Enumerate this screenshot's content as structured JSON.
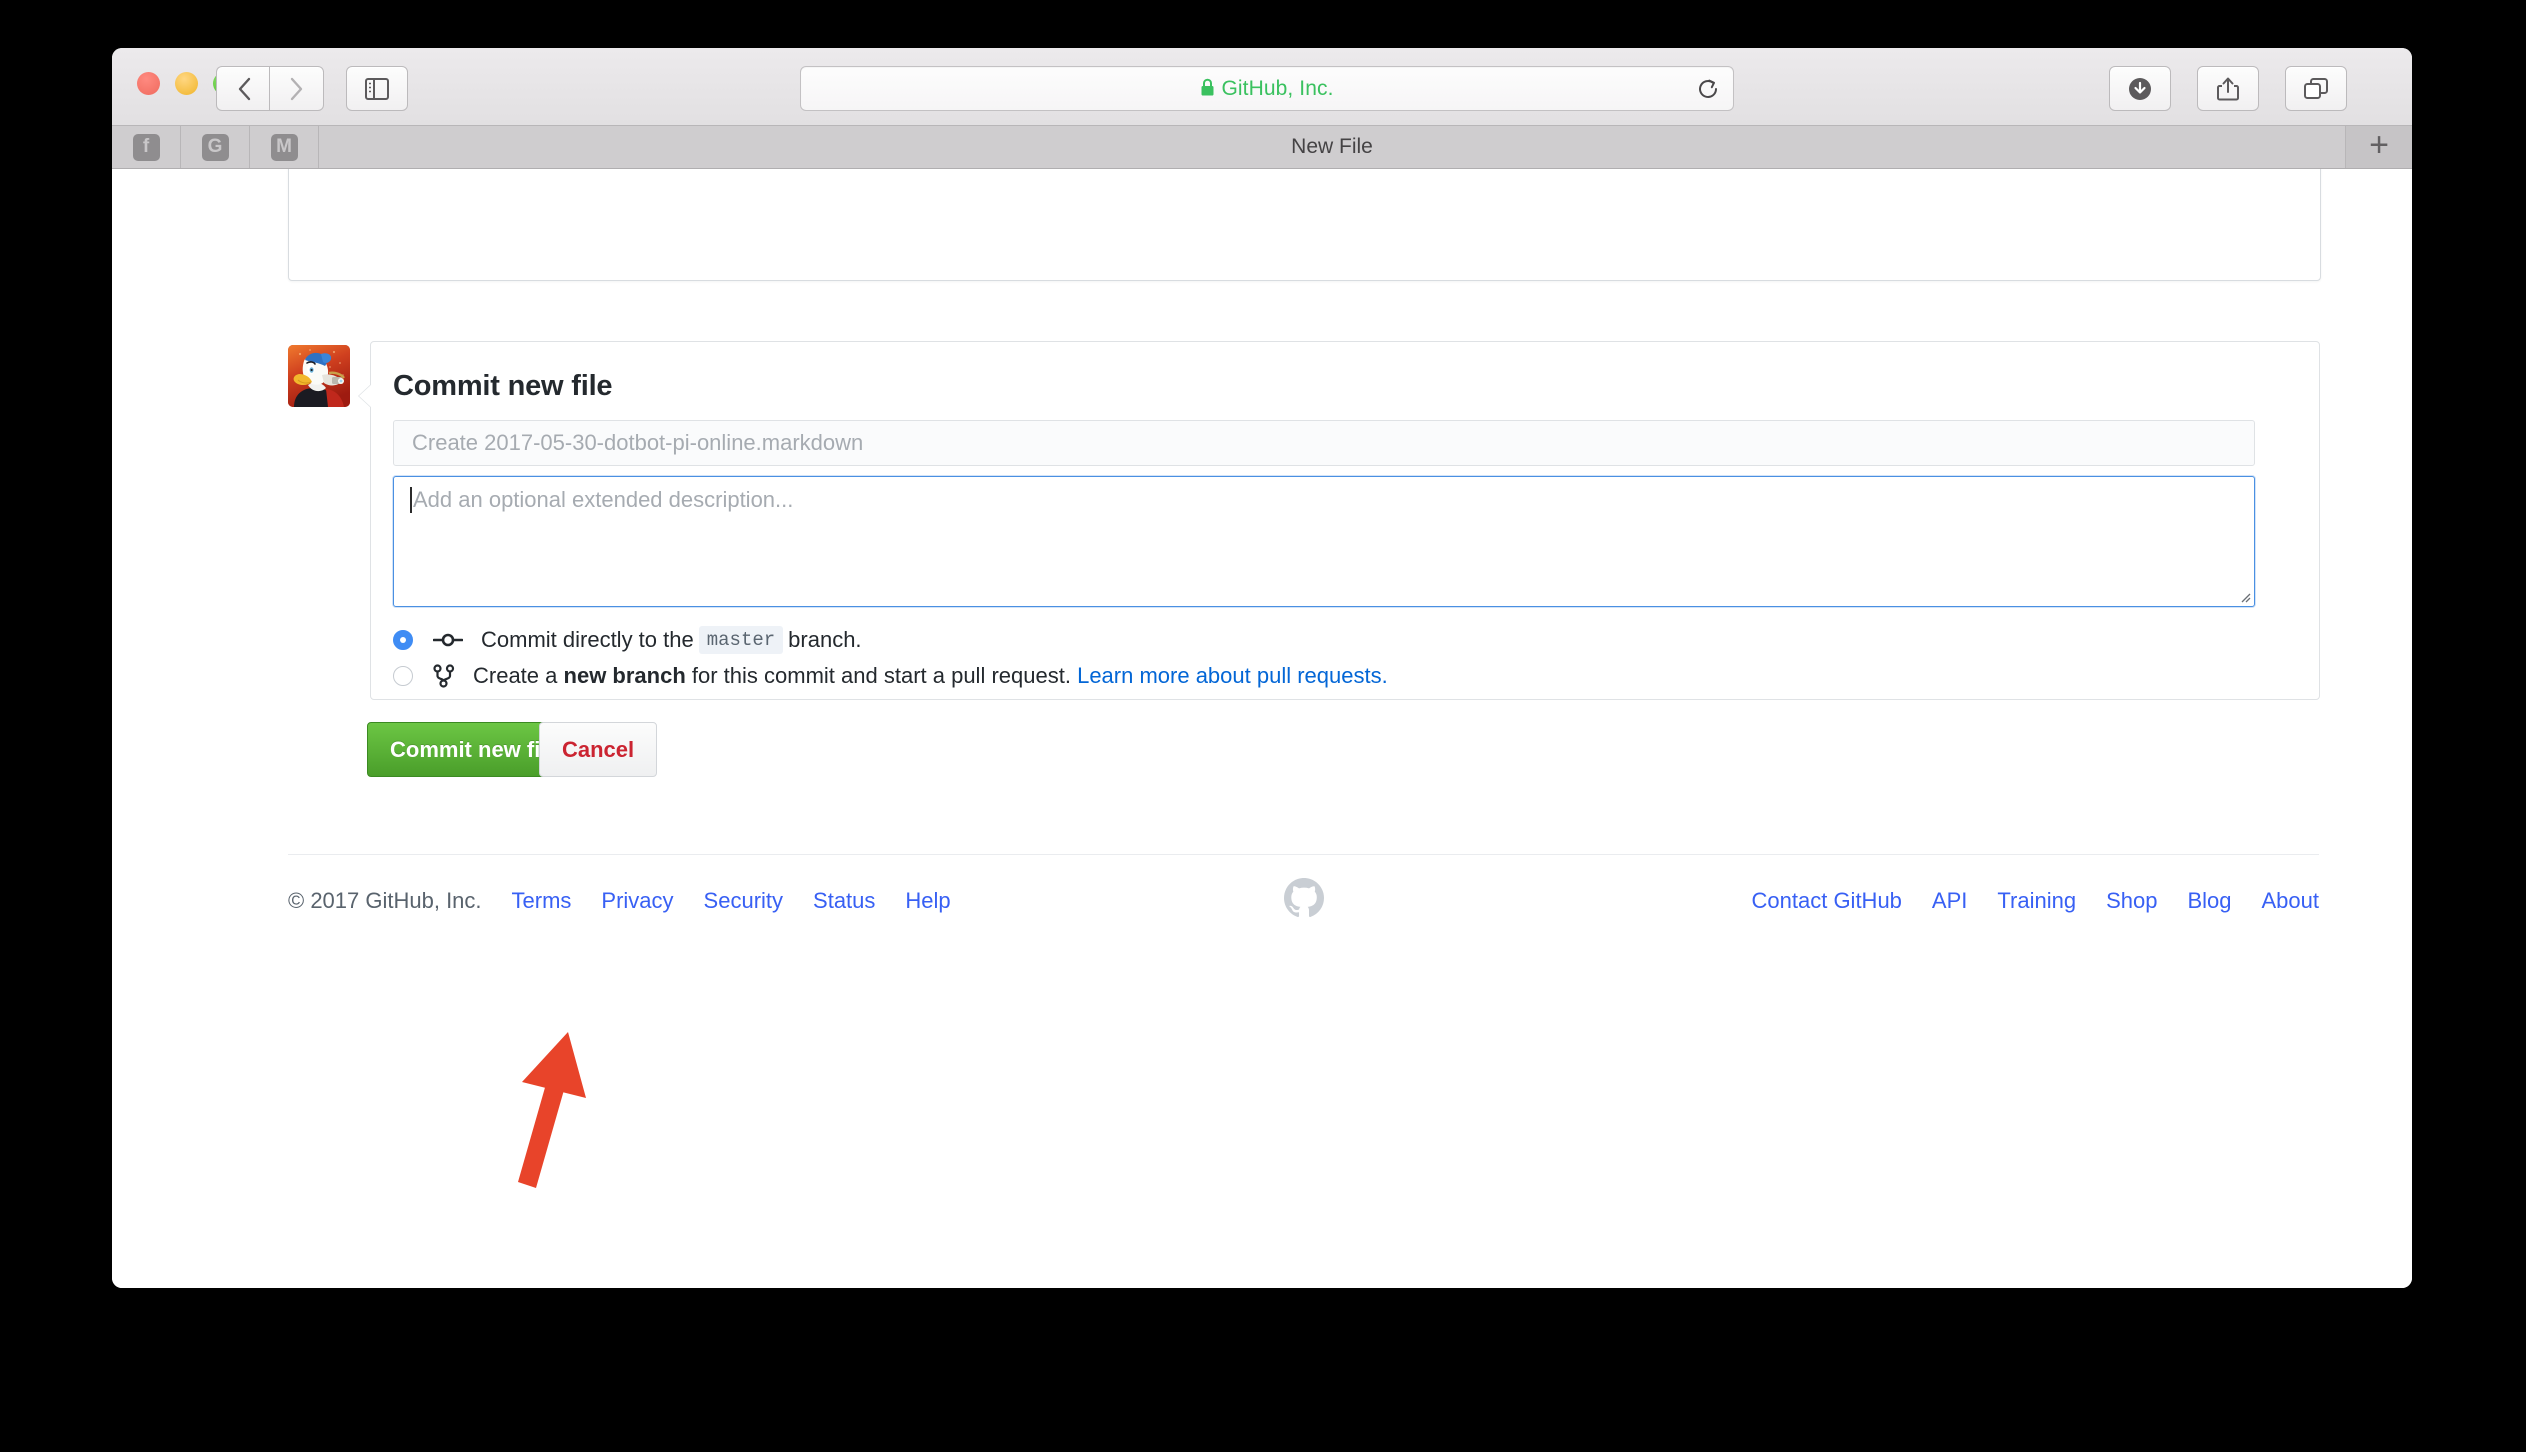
{
  "browser": {
    "url_text": "GitHub, Inc.",
    "lock_icon": "lock-icon",
    "reload_icon": "reload-icon",
    "back_icon": "chevron-left-icon",
    "forward_icon": "chevron-right-icon",
    "sidebar_icon": "sidebar-toggle-icon",
    "download_icon": "download-icon",
    "share_icon": "share-icon",
    "tabs_icon": "show-all-tabs-icon",
    "new_tab_label": "+",
    "pinned_tabs": [
      {
        "label": "f",
        "name": "facebook-favicon"
      },
      {
        "label": "G",
        "name": "google-favicon"
      },
      {
        "label": "M",
        "name": "medium-favicon"
      }
    ],
    "active_tab_title": "New File"
  },
  "commit_form": {
    "avatar_name": "user-avatar",
    "title": "Commit new file",
    "summary_placeholder": "Create 2017-05-30-dotbot-pi-online.markdown",
    "summary_value": "",
    "description_placeholder": "Add an optional extended description...",
    "description_value": "",
    "options": [
      {
        "name": "commit-directly-option",
        "checked": true,
        "icon": "git-commit-icon",
        "text_before": "Commit directly to the",
        "branch": "master",
        "text_after": "branch."
      },
      {
        "name": "create-branch-option",
        "checked": false,
        "icon": "git-branch-icon",
        "text_1": "Create a",
        "bold": "new branch",
        "text_2": "for this commit and start a pull request.",
        "link": "Learn more about pull requests."
      }
    ],
    "submit_label": "Commit new file",
    "cancel_label": "Cancel",
    "accent_green": "#6cc644",
    "accent_blue": "#3f8cf4",
    "danger_red": "#cb2431"
  },
  "footer": {
    "copyright": "© 2017 GitHub, Inc.",
    "left_links": [
      "Terms",
      "Privacy",
      "Security",
      "Status",
      "Help"
    ],
    "right_links": [
      "Contact GitHub",
      "API",
      "Training",
      "Shop",
      "Blog",
      "About"
    ],
    "mark_name": "github-mark-icon"
  },
  "annotation": {
    "arrow_name": "red-arrow-annotation",
    "arrow_color": "#e8442a"
  }
}
